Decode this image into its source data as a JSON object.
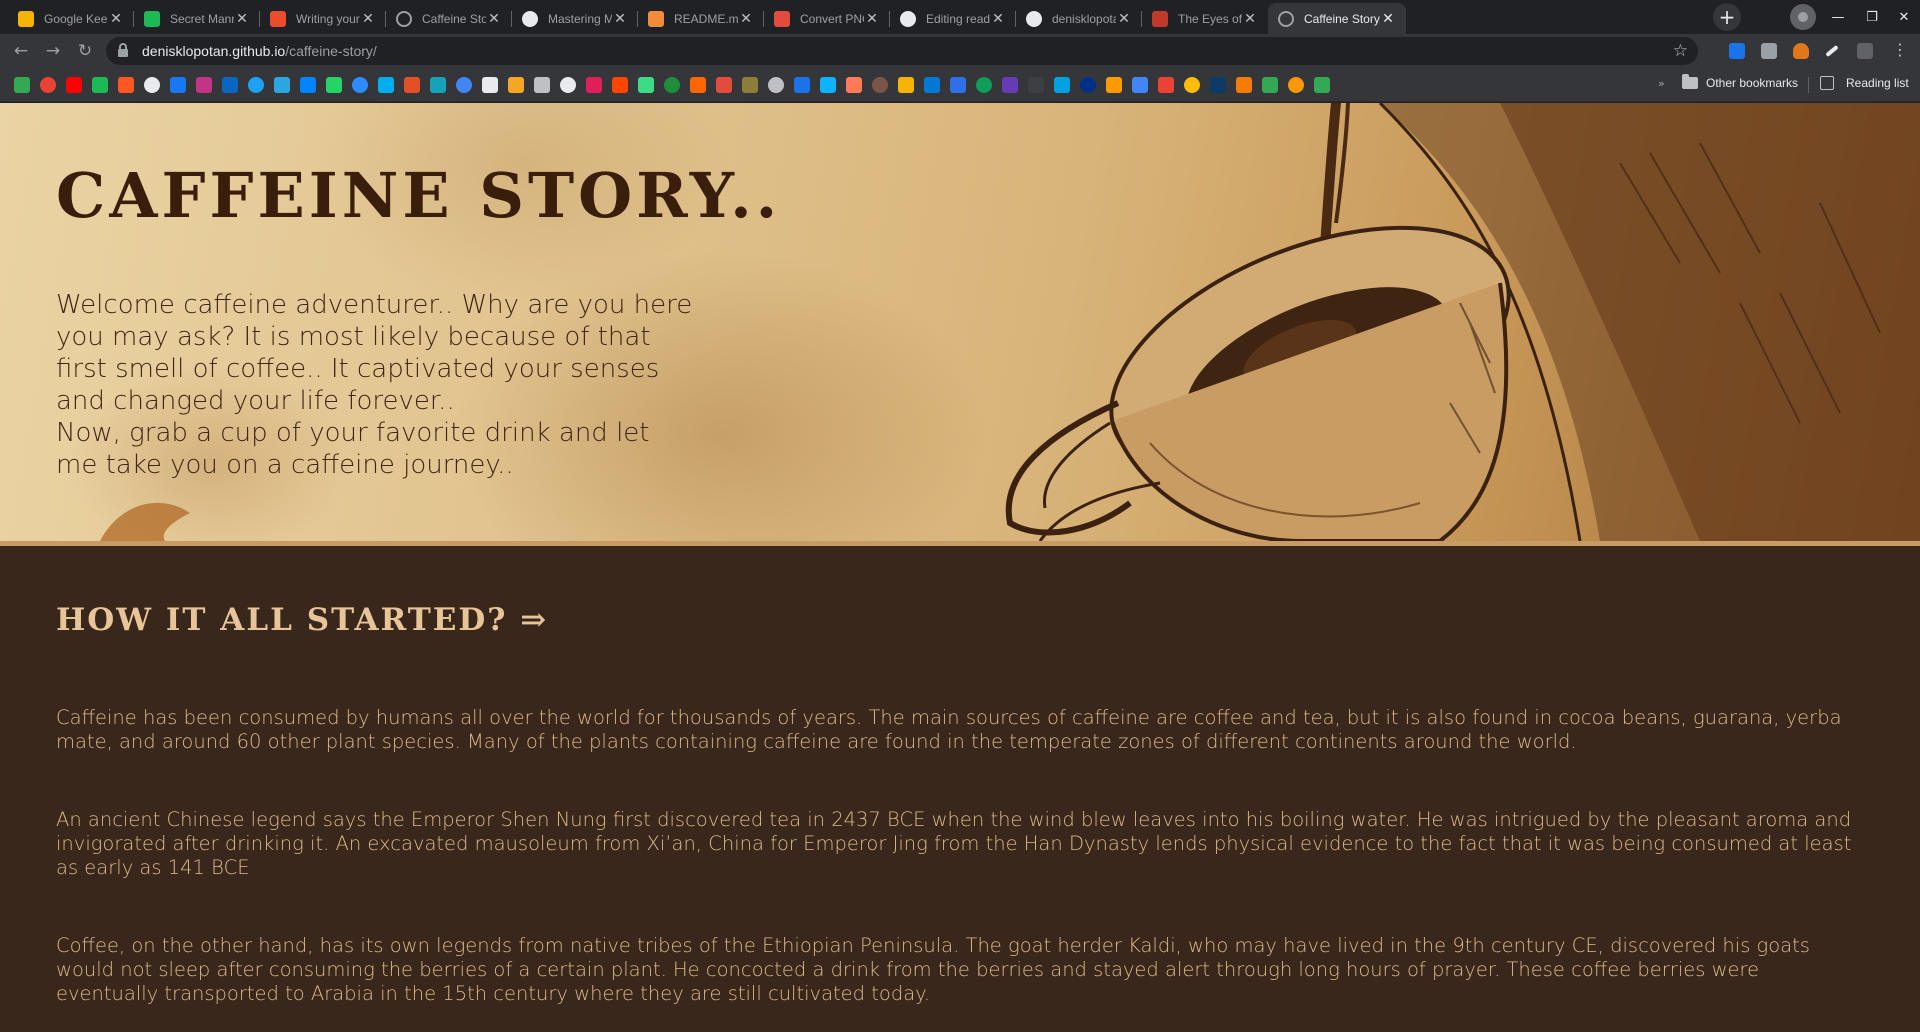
{
  "tabs": [
    {
      "title": "Google Keep",
      "icon": "google-keep-icon",
      "color": "#f4b400"
    },
    {
      "title": "Secret Mann",
      "icon": "spotify-icon",
      "color": "#1db954"
    },
    {
      "title": "Writing your README",
      "icon": "dev-icon",
      "color": "#ea4c2c"
    },
    {
      "title": "Caffeine Story..",
      "icon": "globe-icon",
      "color": "#9aa0a6"
    },
    {
      "title": "Mastering Markdown",
      "icon": "github-icon",
      "color": "#e8eaed"
    },
    {
      "title": "README.md - caffeine",
      "icon": "stackedit-icon",
      "color": "#f28c38"
    },
    {
      "title": "Convert PNG to",
      "icon": "convert-icon",
      "color": "#e24c3c"
    },
    {
      "title": "Editing readme",
      "icon": "github-icon",
      "color": "#e8eaed"
    },
    {
      "title": "denisklopotan/caffeine",
      "icon": "github-icon",
      "color": "#e8eaed"
    },
    {
      "title": "The Eyes of the",
      "icon": "bookmark-site-icon",
      "color": "#c0392b"
    },
    {
      "title": "Caffeine Story..",
      "icon": "globe-icon",
      "color": "#9aa0a6",
      "active": true
    }
  ],
  "toolbar": {
    "url_host": "denisklopotan.github.io",
    "url_path": "/caffeine-story/"
  },
  "bookmarks": {
    "icon_colors": [
      "#34a853",
      "#ea4335",
      "#ff0000",
      "#1db954",
      "#ff5722",
      "#e8eaed",
      "#1877f2",
      "#c13584",
      "#0a66c2",
      "#1da1f2",
      "#2ca5e0",
      "#0084ff",
      "#25d366",
      "#2d8cff",
      "#00aff0",
      "#e34f26",
      "#17a2b8",
      "#4285f4",
      "#e8eaed",
      "#f5a623",
      "#bdc1c6",
      "#e8eaed",
      "#e01e5a",
      "#ff4500",
      "#3ddc84",
      "#1e8e3e",
      "#ff6600",
      "#e24c3c",
      "#8b7d3a",
      "#bdc1c6",
      "#1a73e8",
      "#0db3ff",
      "#ff7a59",
      "#795548",
      "#f4b400",
      "#0078d4",
      "#2f6fe8",
      "#0f9d58",
      "#673ab7",
      "#3c4043",
      "#00a1e0",
      "#003087",
      "#ff9900",
      "#4285f4",
      "#ea4335",
      "#fbbc04",
      "#0d3b66",
      "#f57c00",
      "#34a853",
      "#ff9800",
      "#34a853"
    ],
    "more": "»",
    "other_bookmarks": "Other bookmarks",
    "reading_list": "Reading list"
  },
  "hero": {
    "title": "CAFFEINE STORY..",
    "intro_1": "Welcome caffeine adventurer.. Why are you here you may ask? It is most likely because of that first smell of coffee.. It captivated your senses and changed your life forever..",
    "intro_2": "Now, grab a cup of your favorite drink and let me take you on a caffeine journey.."
  },
  "story": {
    "heading": "HOW IT ALL STARTED? ⇒",
    "paragraphs": [
      "Caffeine has been consumed by humans all over the world for thousands of years. The main sources of caffeine are coffee and tea, but it is also found in cocoa beans, guarana, yerba mate, and around 60 other plant species. Many of the plants containing caffeine are found in the temperate zones of different continents around the world.",
      "An ancient Chinese legend says the Emperor Shen Nung first discovered tea in 2437 BCE when the wind blew leaves into his boiling water. He was intrigued by the pleasant aroma and invigorated after drinking it. An excavated mausoleum from Xi’an, China for Emperor Jing from the Han Dynasty lends physical evidence to the fact that it was being consumed at least as early as 141 BCE",
      "Coffee, on the other hand, has its own legends from native tribes of the Ethiopian Peninsula. The goat herder Kaldi, who may have lived in the 9th century CE, discovered his goats would not sleep after consuming the berries of a certain plant. He concocted a drink from the berries and stayed alert through long hours of prayer. These coffee berries were eventually transported to Arabia in the 15th century where they are still cultivated today."
    ]
  },
  "colors": {
    "hero_title": "#3a1e0c",
    "story_bg": "#3a271b",
    "story_heading": "#e8c598",
    "story_text": "#dcb98c"
  }
}
